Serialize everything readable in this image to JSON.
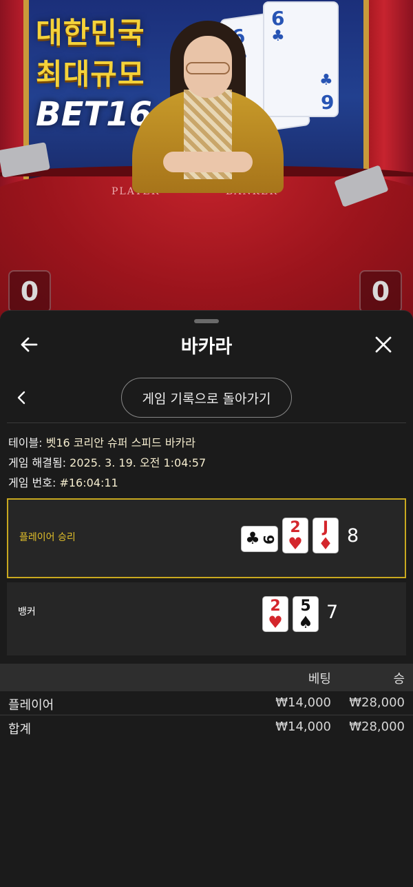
{
  "stream": {
    "promo_line1": "대한민국",
    "promo_line2": "최대규모",
    "promo_brand": "BET16",
    "table_label_player": "PLAYER",
    "table_label_banker": "BANKER",
    "player_score": "0",
    "banker_score": "0",
    "colors": {
      "promo_yellow": "#f4d23a",
      "felt": "#c5232c",
      "backdrop": "#1f3d8c"
    }
  },
  "sheet": {
    "title": "바카라",
    "back_icon": "arrow-left-icon",
    "close_icon": "close-icon",
    "prev_icon": "chevron-left-icon",
    "history_button": "게임 기록으로 돌아가기",
    "info": {
      "table_label": "테이블: ",
      "table_value": "벳16 코리안 슈퍼 스피드 바카라",
      "resolved_label": "게임 해결됨: ",
      "resolved_value": "2025. 3. 19. 오전 1:04:57",
      "number_label": "게임 번호: ",
      "number_value": "#16:04:11"
    },
    "player": {
      "label": "플레이어 승리",
      "total": "8",
      "cards": [
        {
          "rank": "9",
          "suit": "♣",
          "color": "black",
          "sideways": true
        },
        {
          "rank": "2",
          "suit": "♥",
          "color": "red"
        },
        {
          "rank": "J",
          "suit": "♦",
          "color": "red"
        }
      ]
    },
    "banker": {
      "label": "뱅커",
      "total": "7",
      "cards": [
        {
          "rank": "2",
          "suit": "♥",
          "color": "red"
        },
        {
          "rank": "5",
          "suit": "♠",
          "color": "black"
        }
      ]
    },
    "bets": {
      "col_bet": "베팅",
      "col_win": "승",
      "rows": [
        {
          "name": "플레이어",
          "bet": "₩14,000",
          "win": "₩28,000"
        }
      ],
      "total": {
        "name": "합계",
        "bet": "₩14,000",
        "win": "₩28,000"
      }
    },
    "accent_color": "#c9a91f"
  }
}
